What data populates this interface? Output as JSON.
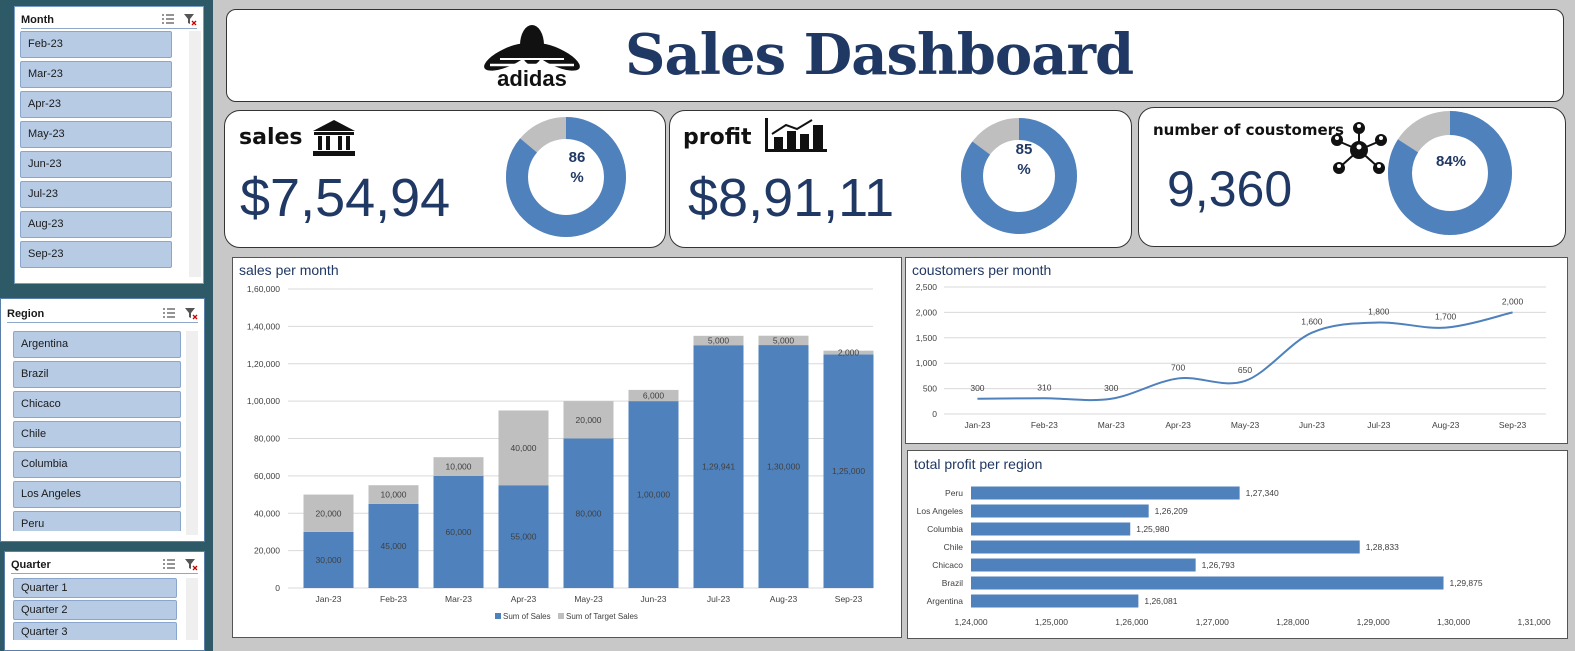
{
  "slicers": {
    "month": {
      "title": "Month",
      "items": [
        "Feb-23",
        "Mar-23",
        "Apr-23",
        "May-23",
        "Jun-23",
        "Jul-23",
        "Aug-23",
        "Sep-23"
      ]
    },
    "region": {
      "title": "Region",
      "items": [
        "Argentina",
        "Brazil",
        "Chicaco",
        "Chile",
        "Columbia",
        "Los Angeles",
        "Peru"
      ]
    },
    "quarter": {
      "title": "Quarter",
      "items": [
        "Quarter 1",
        "Quarter 2",
        "Quarter 3"
      ]
    }
  },
  "header": {
    "brand": "adidas",
    "title": "Sales Dashboard"
  },
  "kpis": {
    "sales": {
      "label": "sales",
      "value": "$7,54,94",
      "pct_line1": "86",
      "pct_line2": "%",
      "pct": 86,
      "icon": "bank-icon"
    },
    "profit": {
      "label": "profit",
      "value": "$8,91,11",
      "pct_line1": "85",
      "pct_line2": "%",
      "pct": 85,
      "icon": "bar-growth-icon"
    },
    "customers": {
      "label": "number of coustomers",
      "value": "9,360",
      "pct_text": "84%",
      "pct": 84,
      "icon": "network-people-icon"
    }
  },
  "colors": {
    "blue": "#4f81bd",
    "grey": "#bfbfbf",
    "navy": "#203864"
  },
  "chart_data": [
    {
      "type": "bar",
      "stacked": true,
      "title": "sales per month",
      "categories": [
        "Jan-23",
        "Feb-23",
        "Mar-23",
        "Apr-23",
        "May-23",
        "Jun-23",
        "Jul-23",
        "Aug-23",
        "Sep-23"
      ],
      "series": [
        {
          "name": "Sum of Sales",
          "values": [
            30000,
            45000,
            60000,
            55000,
            80000,
            100000,
            129941,
            130000,
            125000
          ],
          "labels": [
            "30,000",
            "45,000",
            "60,000",
            "55,000",
            "80,000",
            "1,00,000",
            "1,29,941",
            "1,30,000",
            "1,25,000"
          ]
        },
        {
          "name": "Sum of Target Sales",
          "values": [
            20000,
            10000,
            10000,
            40000,
            20000,
            6000,
            5000,
            5000,
            2000
          ],
          "labels": [
            "20,000",
            "10,000",
            "10,000",
            "40,000",
            "20,000",
            "6,000",
            "5,000",
            "5,000",
            "2,000"
          ]
        }
      ],
      "ylim": [
        0,
        160000
      ],
      "yticks": [
        "0",
        "20,000",
        "40,000",
        "60,000",
        "80,000",
        "1,00,000",
        "1,20,000",
        "1,40,000",
        "1,60,000"
      ],
      "legend": "bottom",
      "grid": true
    },
    {
      "type": "line",
      "title": "coustomers per month",
      "categories": [
        "Jan-23",
        "Feb-23",
        "Mar-23",
        "Apr-23",
        "May-23",
        "Jun-23",
        "Jul-23",
        "Aug-23",
        "Sep-23"
      ],
      "values": [
        300,
        310,
        300,
        700,
        650,
        1600,
        1800,
        1700,
        2000
      ],
      "labels": [
        "300",
        "310",
        "300",
        "700",
        "650",
        "1,600",
        "1,800",
        "1,700",
        "2,000"
      ],
      "ylim": [
        0,
        2500
      ],
      "yticks": [
        "0",
        "500",
        "1,000",
        "1,500",
        "2,000",
        "2,500"
      ],
      "smooth": true,
      "grid": true
    },
    {
      "type": "bar",
      "orientation": "horizontal",
      "title": "total profit per region",
      "categories": [
        "Peru",
        "Los Angeles",
        "Columbia",
        "Chile",
        "Chicaco",
        "Brazil",
        "Argentina"
      ],
      "values": [
        127340,
        126209,
        125980,
        128833,
        126793,
        129875,
        126081
      ],
      "labels": [
        "1,27,340",
        "1,26,209",
        "1,25,980",
        "1,28,833",
        "1,26,793",
        "1,29,875",
        "1,26,081"
      ],
      "xlim": [
        124000,
        131000
      ],
      "xticks": [
        "1,24,000",
        "1,25,000",
        "1,26,000",
        "1,27,000",
        "1,28,000",
        "1,29,000",
        "1,30,000",
        "1,31,000"
      ]
    }
  ]
}
